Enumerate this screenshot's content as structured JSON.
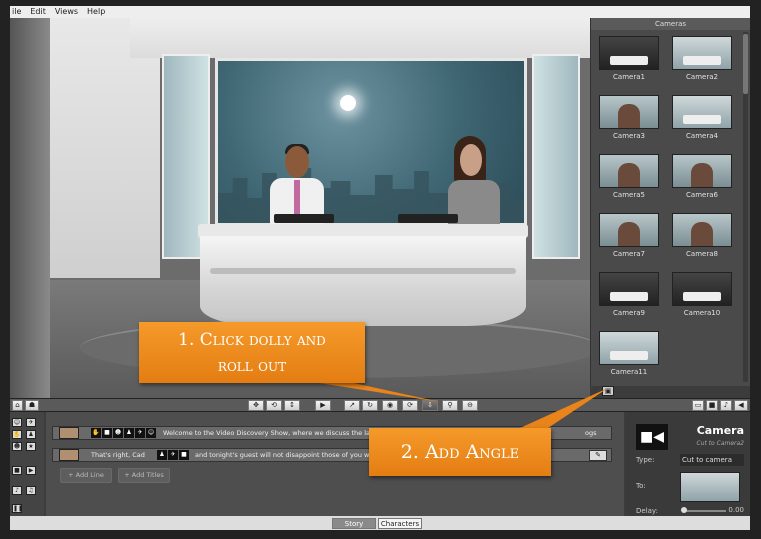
{
  "menubar": {
    "items": [
      "ile",
      "Edit",
      "Views",
      "Help"
    ]
  },
  "camera_panel": {
    "title": "Cameras",
    "cameras": [
      {
        "label": "Camera1"
      },
      {
        "label": "Camera2"
      },
      {
        "label": "Camera3"
      },
      {
        "label": "Camera4"
      },
      {
        "label": "Camera5"
      },
      {
        "label": "Camera6"
      },
      {
        "label": "Camera7"
      },
      {
        "label": "Camera8"
      },
      {
        "label": "Camera9"
      },
      {
        "label": "Camera10"
      },
      {
        "label": "Camera11"
      }
    ]
  },
  "toolbar": {
    "left_icons": [
      "home-icon",
      "people-icon"
    ],
    "center_icons": [
      "move-icon",
      "rotate-icon",
      "updown-icon",
      "play-icon",
      "dolly-icon",
      "orbit-icon",
      "eye-icon",
      "refresh-icon",
      "dolly-roll-out-icon",
      "zoom-icon",
      "zoom-out-icon"
    ],
    "right_icons": [
      "camera-view-icon",
      "video-icon",
      "music-icon",
      "speaker-icon"
    ]
  },
  "script": {
    "lines": [
      {
        "text": "Welcome to the Video Discovery Show, where we discuss the latest",
        "tail": "ogs"
      },
      {
        "text": "That's right, Cad",
        "text2": "and tonight's guest will not disappoint those of you who have w"
      }
    ],
    "add_line": "+ Add Line",
    "add_titles": "+ Add Titles"
  },
  "properties": {
    "title": "Camera",
    "subtitle": "Cut to Camera2",
    "type_label": "Type:",
    "type_value": "Cut to camera",
    "to_label": "To:",
    "delay_label": "Delay:",
    "delay_value": "0.00"
  },
  "tabs": {
    "story": "Story",
    "characters": "Characters"
  },
  "callouts": {
    "step1_line1": "1. Click dolly and",
    "step1_line2": "roll out",
    "step2": "2. Add Angle"
  },
  "colors": {
    "callout": "#f0901f",
    "accent": "#e47d12"
  }
}
